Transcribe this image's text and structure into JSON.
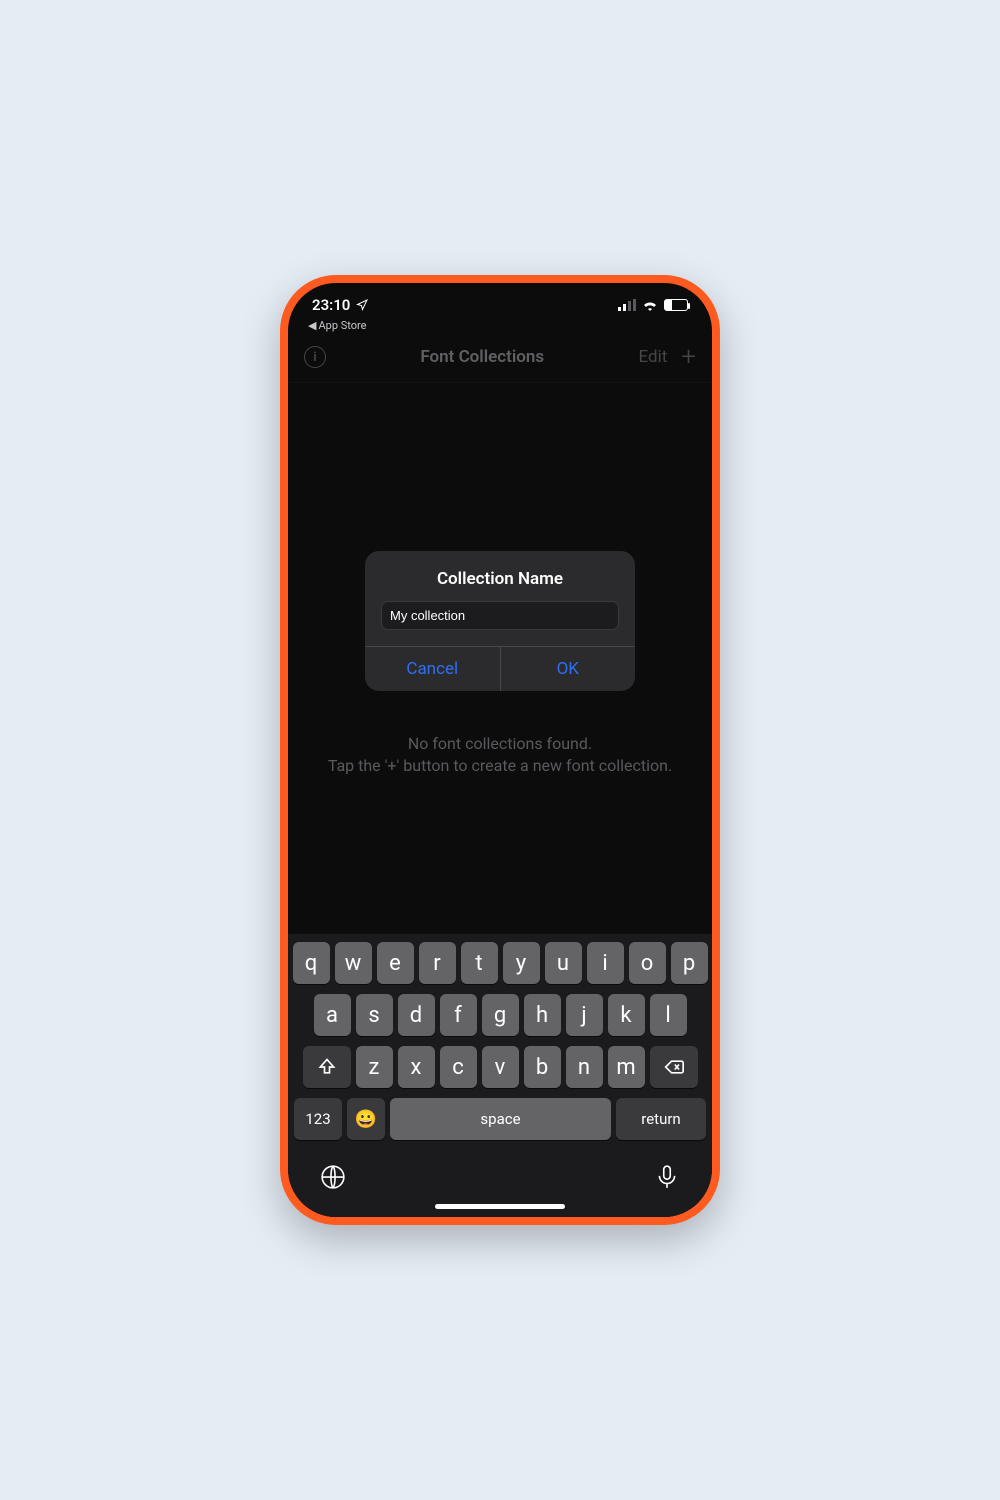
{
  "status": {
    "time": "23:10",
    "back_app": "App Store"
  },
  "nav": {
    "title": "Font Collections",
    "edit": "Edit"
  },
  "alert": {
    "title": "Collection Name",
    "input_value": "My collection",
    "cancel": "Cancel",
    "ok": "OK"
  },
  "empty": {
    "line1": "No font collections found.",
    "line2": "Tap the '+' button to create a new font collection."
  },
  "keyboard": {
    "row1": [
      "q",
      "w",
      "e",
      "r",
      "t",
      "y",
      "u",
      "i",
      "o",
      "p"
    ],
    "row2": [
      "a",
      "s",
      "d",
      "f",
      "g",
      "h",
      "j",
      "k",
      "l"
    ],
    "row3": [
      "z",
      "x",
      "c",
      "v",
      "b",
      "n",
      "m"
    ],
    "numbers": "123",
    "space": "space",
    "return": "return"
  }
}
